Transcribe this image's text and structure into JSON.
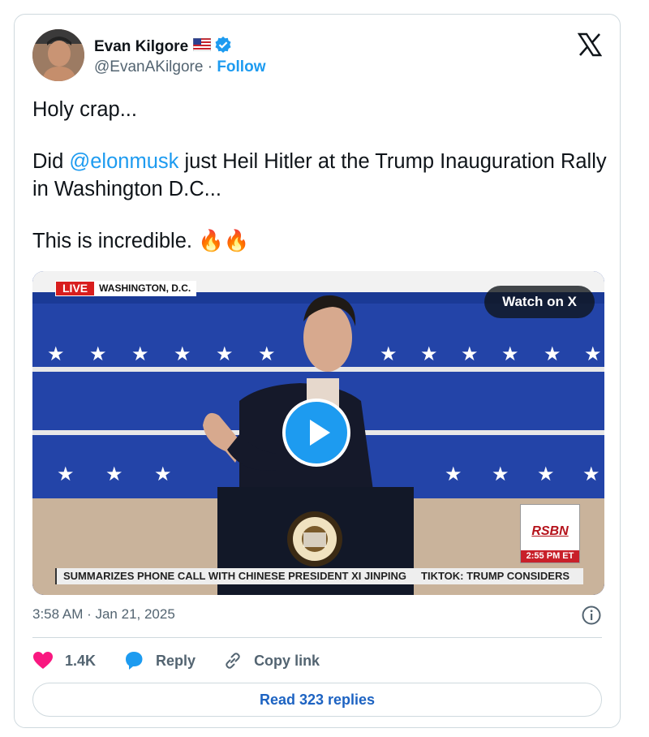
{
  "author": {
    "display_name": "Evan Kilgore",
    "handle": "@EvanAKilgore",
    "separator": "·",
    "follow_label": "Follow"
  },
  "tweet": {
    "line1": "Holy crap...",
    "line2_prefix": "Did ",
    "mention": "@elonmusk",
    "line2_suffix": " just Heil Hitler at the Trump Inauguration Rally in Washington D.C...",
    "line3": "This is incredible.",
    "emoji": "🔥🔥"
  },
  "media": {
    "live_label": "LIVE",
    "location_label": "WASHINGTON, D.C.",
    "watch_label": "Watch on X",
    "network_logo": "RSBN",
    "network_time": "2:55 PM ET",
    "ticker_left": "SUMMARIZES PHONE CALL WITH CHINESE PRESIDENT XI JINPING",
    "ticker_right": "TIKTOK: TRUMP CONSIDERS"
  },
  "meta": {
    "timestamp": "3:58 AM · Jan 21, 2025"
  },
  "actions": {
    "like_count": "1.4K",
    "reply_label": "Reply",
    "copy_label": "Copy link"
  },
  "read_replies_label": "Read 323 replies",
  "colors": {
    "accent": "#1d9bf0",
    "like": "#f91880",
    "text": "#0f1419",
    "muted": "#536471"
  },
  "icons": [
    "us-flag-icon",
    "verified-badge-icon",
    "x-logo-icon",
    "play-icon",
    "info-icon",
    "heart-icon",
    "reply-bubble-icon",
    "link-icon"
  ]
}
